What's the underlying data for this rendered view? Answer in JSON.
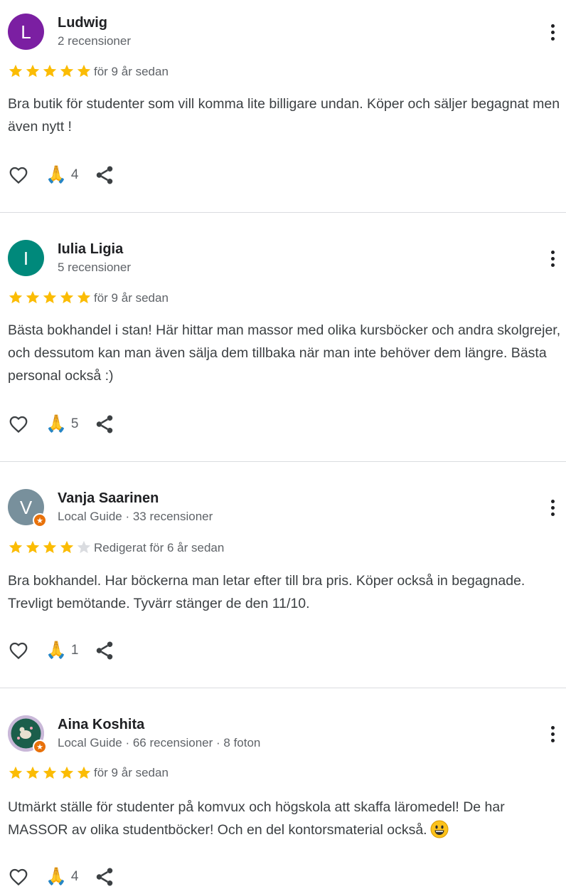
{
  "reviews": [
    {
      "avatar_letter": "L",
      "avatar_color": "#7b1fa2",
      "name": "Ludwig",
      "meta": "2 recensioner",
      "rating": 5,
      "date": "för 9 år sedan",
      "text": "Bra butik för studenter som vill komma lite billigare undan. Köper och säljer begagnat men även nytt !",
      "reactions": "4",
      "local_guide": false
    },
    {
      "avatar_letter": "I",
      "avatar_color": "#00897b",
      "name": "Iulia Ligia",
      "meta": "5 recensioner",
      "rating": 5,
      "date": "för 9 år sedan",
      "text": "Bästa bokhandel i stan! Här hittar man massor med olika kursböcker och andra skolgrejer, och dessutom kan man även sälja dem tillbaka när man inte behöver dem längre. Bästa personal också :)",
      "reactions": "5",
      "local_guide": false
    },
    {
      "avatar_letter": "V",
      "avatar_color": "#78909c",
      "name": "Vanja Saarinen",
      "meta": "Local Guide · 33 recensioner",
      "rating": 4,
      "date": "Redigerat för 6 år sedan",
      "text": "Bra bokhandel. Har böckerna man letar efter till bra pris. Köper också in begagnade. Trevligt bemötande. Tyvärr stänger de den 11/10.",
      "reactions": "1",
      "local_guide": true
    },
    {
      "avatar_letter": "",
      "avatar_color": "#1b5e4b",
      "name": "Aina Koshita",
      "meta": "Local Guide · 66 recensioner · 8 foton",
      "rating": 5,
      "date": "för 9 år sedan",
      "text": "Utmärkt ställe för studenter på komvux och högskola att skaffa läromedel! De har MASSOR av olika studentböcker! Och en del kontorsmaterial också.",
      "reactions": "4",
      "local_guide": true
    }
  ],
  "colors": {
    "star_filled": "#fbbc04",
    "star_empty": "#dadce0",
    "icon": "#3c4043"
  },
  "icons": {
    "like": "heart-outline-icon",
    "reaction": "folded-hands-emoji",
    "share": "share-icon",
    "more": "more-vertical-icon",
    "emoji_in_text": "grinning-face-emoji"
  }
}
